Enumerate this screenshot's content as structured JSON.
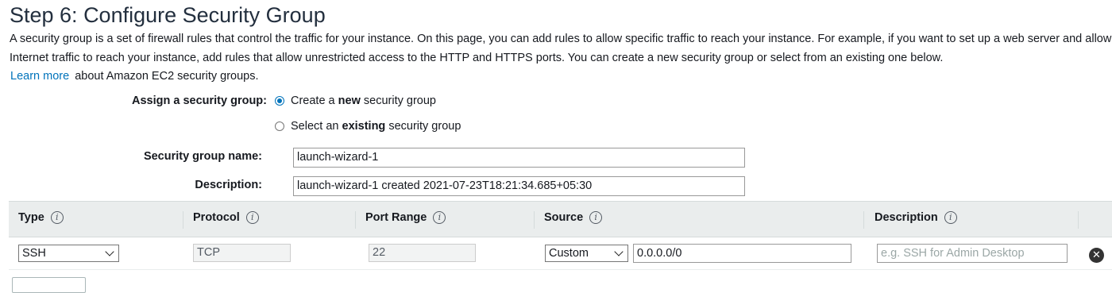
{
  "page": {
    "title": "Step 6: Configure Security Group",
    "intro_text": "A security group is a set of firewall rules that control the traffic for your instance. On this page, you can add rules to allow specific traffic to reach your instance. For example, if you want to set up a web server and allow Internet traffic to reach your instance, add rules that allow unrestricted access to the HTTP and HTTPS ports. You can create a new security group or select from an existing one below.",
    "learn_more": "Learn more",
    "learn_more_suffix": "about Amazon EC2 security groups."
  },
  "assign": {
    "label": "Assign a security group:",
    "option_new": {
      "pre": "Create a ",
      "bold": "new",
      "post": " security group",
      "selected": true
    },
    "option_existing": {
      "pre": "Select an ",
      "bold": "existing",
      "post": " security group",
      "selected": false
    }
  },
  "group_name": {
    "label": "Security group name:",
    "value": "launch-wizard-1"
  },
  "description": {
    "label": "Description:",
    "value": "launch-wizard-1 created 2021-07-23T18:21:34.685+05:30"
  },
  "table": {
    "headers": [
      "Type",
      "Protocol",
      "Port Range",
      "Source",
      "Description"
    ],
    "info_icon": "info-icon",
    "rows": [
      {
        "type": "SSH",
        "protocol": "TCP",
        "port_range": "22",
        "source_mode": "Custom",
        "source_cidr": "0.0.0.0/0",
        "description_placeholder": "e.g. SSH for Admin Desktop",
        "remove_icon": "close-circle-icon"
      }
    ]
  },
  "colors": {
    "link": "#0073bb",
    "header_bg": "#eaeded",
    "title": "#232f3e"
  }
}
